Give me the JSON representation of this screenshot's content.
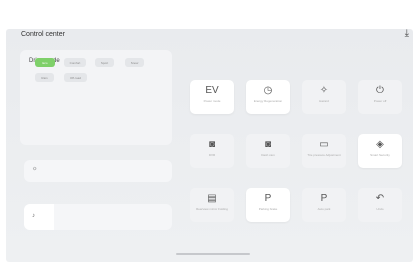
{
  "header": {
    "title": "Control center",
    "close_icon": "close-icon"
  },
  "drive_mode": {
    "label": "Drive mode",
    "modes": [
      "Eco",
      "Comfort",
      "Sport",
      "Snow",
      "Rain",
      "Off-road"
    ],
    "active_index": 0,
    "accent_color": "#7fd06a"
  },
  "sliders": [
    {
      "icon": "sun-icon",
      "glyph": "☼",
      "level": 0
    },
    {
      "icon": "volume-icon",
      "glyph": "♪",
      "level": 0.2
    }
  ],
  "tiles": [
    {
      "name": "ev-mode",
      "glyph": "EV",
      "label": "Power mode",
      "active": true
    },
    {
      "name": "energy-regen",
      "glyph": "◷",
      "label": "Energy Regeneration",
      "active": true
    },
    {
      "name": "hazard",
      "glyph": "✧",
      "label": "Hazard",
      "active": false
    },
    {
      "name": "power-off",
      "glyph": "⏻",
      "label": "Power off",
      "active": false
    },
    {
      "name": "dvr",
      "glyph": "◙",
      "label": "DVR",
      "active": false
    },
    {
      "name": "dash-cam",
      "glyph": "◙",
      "label": "Dash cam",
      "active": false
    },
    {
      "name": "tire-pressure",
      "glyph": "▭",
      "label": "Tire pressure Adjustment",
      "active": false
    },
    {
      "name": "smart-security",
      "glyph": "◈",
      "label": "Smart Security",
      "active": true
    },
    {
      "name": "rearview-mirror",
      "glyph": "▤",
      "label": "Rearview mirror Folding",
      "active": false
    },
    {
      "name": "parking-brake",
      "glyph": "P",
      "label": "Parking brake",
      "active": true
    },
    {
      "name": "auto-park",
      "glyph": "P",
      "label": "Auto park",
      "active": false
    },
    {
      "name": "undo",
      "glyph": "↶",
      "label": "Undo",
      "active": false
    }
  ]
}
